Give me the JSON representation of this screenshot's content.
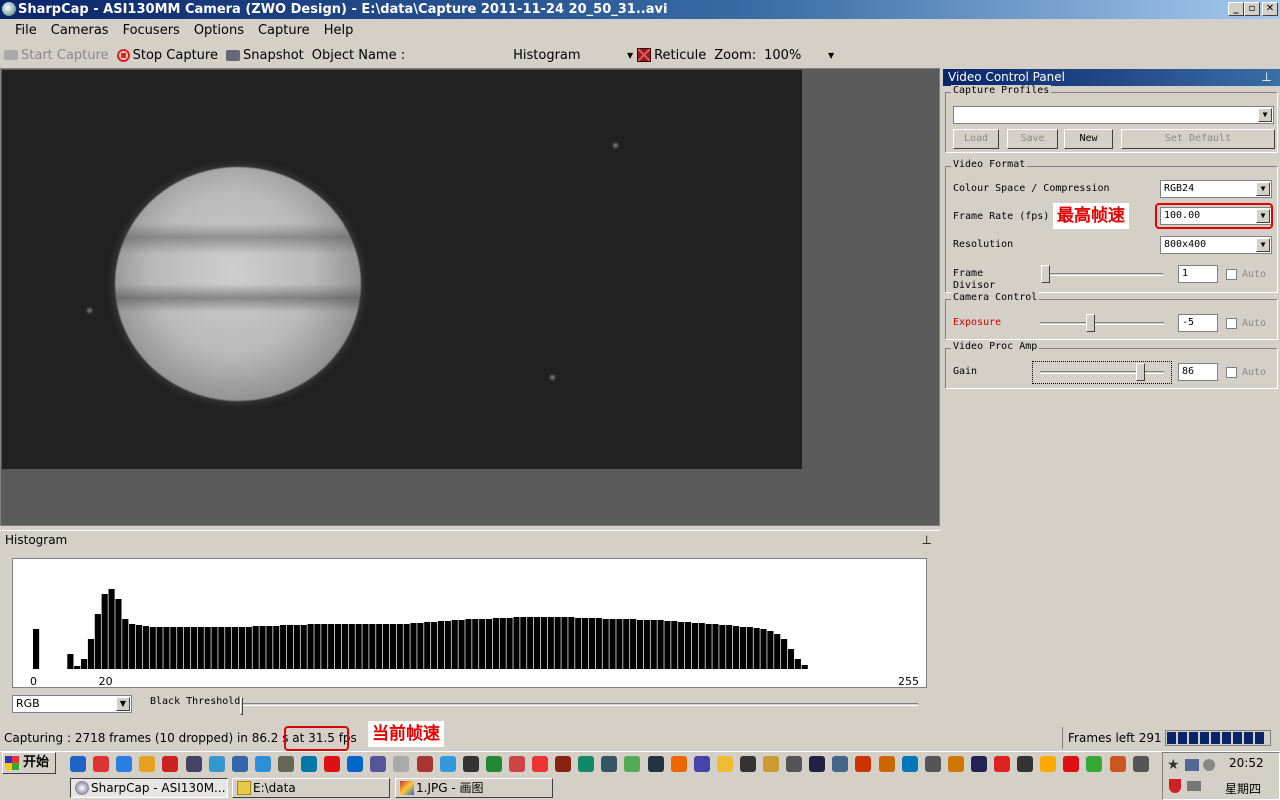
{
  "window": {
    "title": "SharpCap - ASI130MM Camera (ZWO Design) - E:\\data\\Capture 2011-11-24 20_50_31..avi",
    "min": "_",
    "max": "▫",
    "close": "✕"
  },
  "menu": [
    "File",
    "Cameras",
    "Focusers",
    "Options",
    "Capture",
    "Help"
  ],
  "toolbar": {
    "start_capture": "Start Capture",
    "stop_capture": "Stop Capture",
    "snapshot": "Snapshot",
    "object_name": "Object Name :",
    "view_mode": "Histogram",
    "reticule": "Reticule",
    "zoom_label": "Zoom:",
    "zoom_value": "100%"
  },
  "histogram": {
    "title": "Histogram",
    "pin": "⊥",
    "tick_0": "0",
    "tick_20": "20",
    "tick_255": "255",
    "channel": "RGB",
    "black_threshold_label": "Black Threshold"
  },
  "chart_data": {
    "type": "bar",
    "title": "",
    "xlabel": "",
    "ylabel": "",
    "xlim": [
      0,
      255
    ],
    "ylim": [
      0,
      100
    ],
    "x": [
      0,
      2,
      4,
      6,
      8,
      10,
      12,
      14,
      16,
      18,
      20,
      22,
      24,
      26,
      28,
      30,
      32,
      34,
      36,
      38,
      40,
      42,
      44,
      46,
      48,
      50,
      52,
      54,
      56,
      58,
      60,
      62,
      64,
      66,
      68,
      70,
      72,
      74,
      76,
      78,
      80,
      82,
      84,
      86,
      88,
      90,
      92,
      94,
      96,
      98,
      100,
      102,
      104,
      106,
      108,
      110,
      112,
      114,
      116,
      118,
      120,
      122,
      124,
      126,
      128,
      130,
      132,
      134,
      136,
      138,
      140,
      142,
      144,
      146,
      148,
      150,
      152,
      154,
      156,
      158,
      160,
      162,
      164,
      166,
      168,
      170,
      172,
      174,
      176,
      178,
      180,
      182,
      184,
      186,
      188,
      190,
      192,
      194,
      196,
      198,
      200,
      202,
      204,
      206,
      208,
      210,
      212,
      214,
      216,
      218,
      220,
      222,
      224,
      226,
      228,
      230,
      232,
      234,
      236,
      238,
      240,
      242,
      244,
      246,
      248,
      250,
      252,
      254
    ],
    "values": [
      40,
      0,
      0,
      0,
      0,
      15,
      3,
      10,
      30,
      55,
      75,
      80,
      70,
      50,
      45,
      44,
      43,
      42,
      42,
      42,
      42,
      42,
      42,
      42,
      42,
      42,
      42,
      42,
      42,
      42,
      42,
      42,
      43,
      43,
      43,
      43,
      44,
      44,
      44,
      44,
      45,
      45,
      45,
      45,
      45,
      45,
      45,
      45,
      45,
      45,
      45,
      45,
      45,
      45,
      45,
      46,
      46,
      47,
      47,
      48,
      48,
      49,
      49,
      50,
      50,
      50,
      50,
      51,
      51,
      51,
      52,
      52,
      52,
      52,
      52,
      52,
      52,
      52,
      52,
      51,
      51,
      51,
      51,
      50,
      50,
      50,
      50,
      50,
      49,
      49,
      49,
      49,
      48,
      48,
      47,
      47,
      46,
      46,
      45,
      45,
      44,
      44,
      43,
      42,
      42,
      41,
      40,
      38,
      35,
      30,
      20,
      10,
      4,
      0,
      0,
      0,
      0,
      0,
      0,
      0,
      0,
      0,
      0,
      0,
      0,
      0,
      0,
      0
    ]
  },
  "panel": {
    "title": "Video Control Panel",
    "pin": "⊥",
    "capture_profiles": {
      "title": "Capture Profiles",
      "selected": "",
      "load": "Load",
      "save": "Save",
      "new": "New",
      "set_default": "Set Default"
    },
    "video_format": {
      "title": "Video Format",
      "colour_label": "Colour Space / Compression",
      "colour_value": "RGB24",
      "frame_rate_label": "Frame Rate (fps)",
      "frame_rate_value": "100.00",
      "resolution_label": "Resolution",
      "resolution_value": "800x400",
      "frame_divisor_label_1": "Frame",
      "frame_divisor_label_2": "Divisor",
      "frame_divisor_value": "1",
      "auto": "Auto",
      "frame_divisor_level": 0.0
    },
    "camera_control": {
      "title": "Camera Control",
      "exposure_label": "Exposure",
      "exposure_value": "-5",
      "auto": "Auto",
      "exposure_level": 0.4
    },
    "video_proc_amp": {
      "title": "Video Proc Amp",
      "gain_label": "Gain",
      "gain_value": "86",
      "auto": "Auto",
      "gain_level": 0.84
    }
  },
  "annotations": {
    "max_fps": "最高帧速",
    "current_fps": "当前帧速"
  },
  "status": {
    "capturing": "Capturing : 2718 frames (10 dropped) in 86.2 s at 31.5 fps",
    "frames_left": "Frames left 291",
    "progress_segments": 9
  },
  "taskbar": {
    "start": "开始",
    "clock": "20:52",
    "weekday": "星期四",
    "tasks": [
      {
        "label": "SharpCap - ASI130M..."
      },
      {
        "label": "E:\\data"
      },
      {
        "label": "1.JPG - 画图"
      }
    ],
    "quick_launch_colors": [
      "#1f63c6",
      "#d33",
      "#2a7de1",
      "#e8a020",
      "#c22",
      "#446",
      "#39c",
      "#36a",
      "#2b8fd9",
      "#665",
      "#07a",
      "#d11",
      "#06c",
      "#559",
      "#aaa",
      "#a33",
      "#39d",
      "#333",
      "#283",
      "#c44",
      "#e33",
      "#821",
      "#186",
      "#356",
      "#5a5",
      "#234",
      "#e60",
      "#44a",
      "#eb3",
      "#333",
      "#c93",
      "#555",
      "#224",
      "#468",
      "#c30",
      "#c60",
      "#07b",
      "#555",
      "#c70",
      "#225",
      "#d22",
      "#333",
      "#fa0",
      "#d11",
      "#3a3",
      "#c52",
      "#555"
    ]
  }
}
